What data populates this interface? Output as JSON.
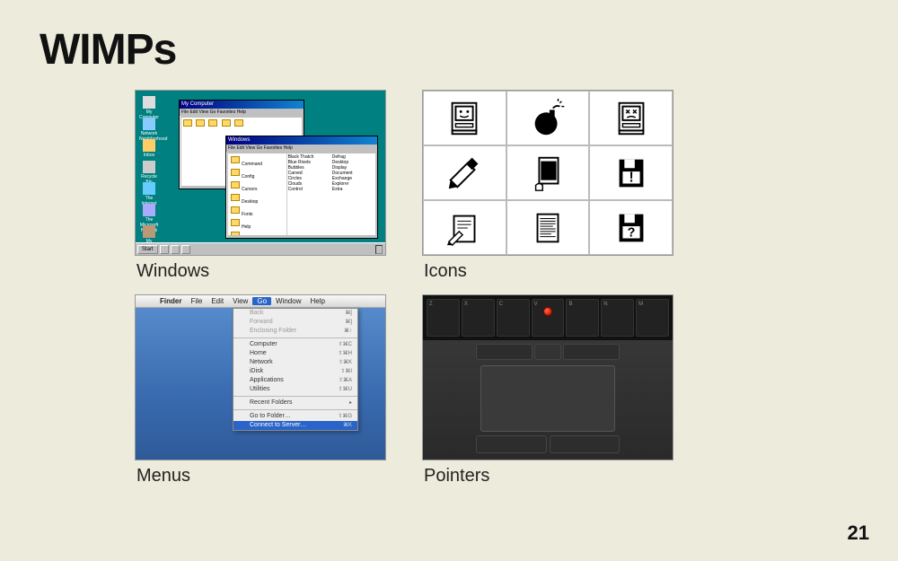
{
  "title": "WIMPs",
  "page_number": "21",
  "quadrants": {
    "windows": {
      "caption": "Windows"
    },
    "icons": {
      "caption": "Icons"
    },
    "menus": {
      "caption": "Menus"
    },
    "pointers": {
      "caption": "Pointers"
    }
  },
  "win98": {
    "start_label": "Start",
    "desktop_icons": [
      "My Computer",
      "Network Neighborhood",
      "Inbox",
      "Recycle Bin",
      "The Internet",
      "The Microsoft Network",
      "My Briefcase"
    ],
    "window_titles": [
      "My Computer",
      "Windows"
    ],
    "menu_items": "File  Edit  View  Go  Favorites  Help"
  },
  "mac_menu": {
    "menubar": [
      "Finder",
      "File",
      "Edit",
      "View",
      "Go",
      "Window",
      "Help"
    ],
    "open_index": 4,
    "items": [
      {
        "label": "Back",
        "shortcut": "⌘[",
        "disabled": true
      },
      {
        "label": "Forward",
        "shortcut": "⌘]",
        "disabled": true
      },
      {
        "label": "Enclosing Folder",
        "shortcut": "⌘↑",
        "disabled": true
      },
      {
        "sep": true
      },
      {
        "label": "Computer",
        "shortcut": "⇧⌘C"
      },
      {
        "label": "Home",
        "shortcut": "⇧⌘H"
      },
      {
        "label": "Network",
        "shortcut": "⇧⌘K"
      },
      {
        "label": "iDisk",
        "shortcut": "⇧⌘I"
      },
      {
        "label": "Applications",
        "shortcut": "⇧⌘A"
      },
      {
        "label": "Utilities",
        "shortcut": "⇧⌘U"
      },
      {
        "sep": true
      },
      {
        "label": "Recent Folders",
        "submenu": true
      },
      {
        "sep": true
      },
      {
        "label": "Go to Folder…",
        "shortcut": "⇧⌘G"
      },
      {
        "label": "Connect to Server…",
        "shortcut": "⌘K",
        "selected": true
      }
    ]
  },
  "keyboard_row": [
    "Z",
    "X",
    "C",
    "V",
    "B",
    "N",
    "M"
  ]
}
